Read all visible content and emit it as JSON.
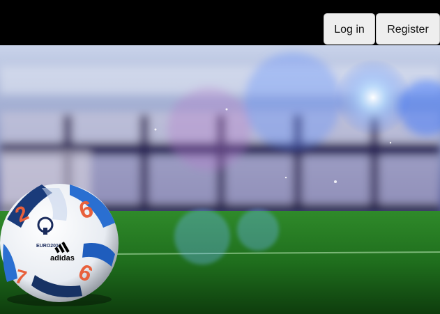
{
  "header": {
    "login_label": "Log in",
    "register_label": "Register"
  },
  "hero": {
    "image": "stadium-football-hero",
    "ball_brand": "adidas",
    "ball_logo": "EURO2016"
  },
  "colors": {
    "topbar": "#000000",
    "button_bg": "#eeeeee",
    "pitch": "#1e7a1e"
  }
}
